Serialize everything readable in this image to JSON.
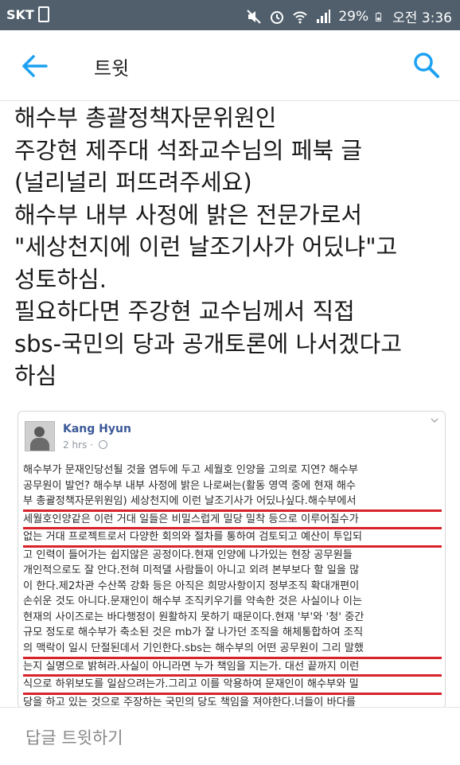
{
  "status_bar": {
    "carrier": "SKT",
    "battery": "29%",
    "time": "오전 3:36"
  },
  "app_bar": {
    "title": "트윗"
  },
  "tweet": {
    "lines": [
      "해수부 총괄정책자문위원인",
      "주강현 제주대 석좌교수님의 페북 글",
      "(널리널리 퍼뜨려주세요)",
      "해수부 내부 사정에 밝은 전문가로서",
      "\"세상천지에 이런 날조기사가 어딨냐\"고",
      "성토하심.",
      "필요하다면 주강현 교수님께서 직접",
      "sbs-국민의 당과 공개토론에 나서겠다고",
      "하심"
    ]
  },
  "embedded_post": {
    "author": "Kang Hyun",
    "time": "2 hrs",
    "lines": [
      "해수부가 문재인당선될 것을 염두에 두고 세월호 인양을 고의로 지연? 해수부",
      "공무원이 발언? 해수부 내부 사정에 밝은 나로써는(활동 영역 중에 현재 해수",
      "부 총괄정책자문위원임) 세상천지에 이런 날조기사가 어딨나싶다.해수부에서",
      "세월호인양같은 이런 거대 일들은 비밀스럽게 밀당 밀착 등으로 이루어질수가",
      "없는 거대 프로젝트로서 다양한 회의와 절차를 통하여 검토되고 예산이 투입되",
      "고 인력이 들어가는 쉽지않은 공정이다.현재 인양에 나가있는 현장 공무원들",
      "개인적으로도 잘 안다.전혀 미적댈 사람들이 아니고 외려 본부보다 할 일을 많",
      "이 한다.제2차관 수산쪽 강화 등은 아직은 희망사항이지 정부조직 확대개편이",
      "손쉬운 것도 아니다.문재인이 해수부 조직키우기를 약속한 것은 사실이나 이는",
      "현재의 사이즈로는 바다행정이 원활하지 못하기 때문이다.현재 '부'와 '청' 중간",
      "규모 정도로 해수부가 축소된 것은 mb가 잘 나가던 조직을 해체통합하여 조직",
      "의 맥락이 일시 단절된데서 기인한다.sbs는 해수부의 어떤 공무원이 그리 말했",
      "는지 실명으로 밝혀라.사실이 아니라면 누가 책임을 지는가. 대선 끝까지 이런",
      "식으로 하위보도를 일삼으려는가.그리고 이를 악용하여 문재인이 해수부와 밀",
      "당을 하고 있는 것으로 주장하는 국민의 당도 책임을 져야한다.너들이 바다를"
    ]
  },
  "reply_bar": {
    "placeholder": "답글 트윗하기"
  },
  "colors": {
    "status_bar": "#515f6c",
    "accent": "#1da1f2",
    "underline": "#d8232a",
    "fb_name": "#3b5998"
  }
}
